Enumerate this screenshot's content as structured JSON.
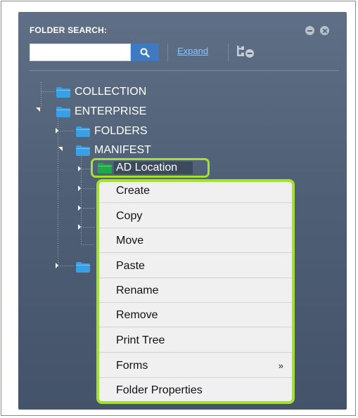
{
  "panel": {
    "title": "FOLDER SEARCH:",
    "search": {
      "value": "",
      "placeholder": ""
    },
    "expand_label": "Expand"
  },
  "tree": {
    "nodes": [
      {
        "label": "COLLECTION",
        "icon": "folder-icon",
        "color": "#3aa0e6"
      },
      {
        "label": "ENTERPRISE",
        "icon": "folder-icon",
        "color": "#3aa0e6",
        "expanded": true
      },
      {
        "label": "FOLDERS",
        "icon": "folder-icon",
        "color": "#3aa0e6"
      },
      {
        "label": "MANIFEST",
        "icon": "folder-icon",
        "color": "#3aa0e6",
        "expanded": true
      },
      {
        "label": "AD Location",
        "icon": "folder-icon",
        "color": "#22a84a",
        "selected": true
      }
    ]
  },
  "context_menu": {
    "items": [
      {
        "label": "Create"
      },
      {
        "label": "Copy"
      },
      {
        "label": "Move"
      },
      {
        "label": "Paste"
      },
      {
        "label": "Rename"
      },
      {
        "label": "Remove"
      },
      {
        "label": "Print Tree"
      },
      {
        "label": "Forms",
        "submenu_indicator": "»"
      },
      {
        "label": "Folder Properties"
      }
    ]
  },
  "colors": {
    "highlight": "#a6e02f",
    "panel_bg": "#55657c",
    "link": "#8fc2f2",
    "search_button": "#3f79c0"
  }
}
